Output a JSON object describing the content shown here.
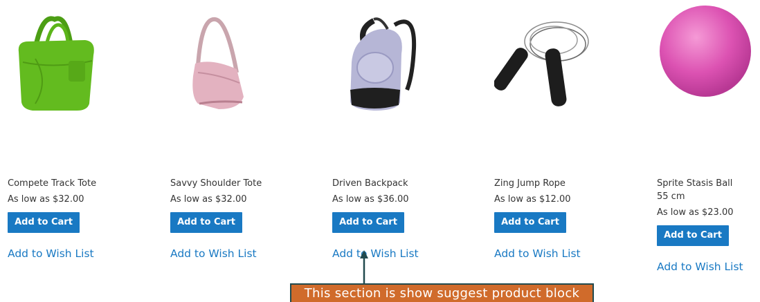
{
  "products": [
    {
      "name": "Compete Track Tote",
      "price": "As low as $32.00",
      "cart_label": "Add to Cart",
      "wish_label": "Add to Wish List"
    },
    {
      "name": "Savvy Shoulder Tote",
      "price": "As low as $32.00",
      "cart_label": "Add to Cart",
      "wish_label": "Add to Wish List"
    },
    {
      "name": "Driven Backpack",
      "price": "As low as $36.00",
      "cart_label": "Add to Cart",
      "wish_label": "Add to Wish List"
    },
    {
      "name": "Zing Jump Rope",
      "price": "As low as $12.00",
      "cart_label": "Add to Cart",
      "wish_label": "Add to Wish List"
    },
    {
      "name": "Sprite Stasis Ball 55 cm",
      "price": "As low as $23.00",
      "cart_label": "Add to Cart",
      "wish_label": "Add to Wish List"
    }
  ],
  "annotation": {
    "text": "This section is show suggest product block"
  },
  "colors": {
    "primary_button": "#1979c3",
    "link": "#1979c3",
    "callout_bg": "#d06b2b",
    "callout_border": "#214a4e"
  }
}
